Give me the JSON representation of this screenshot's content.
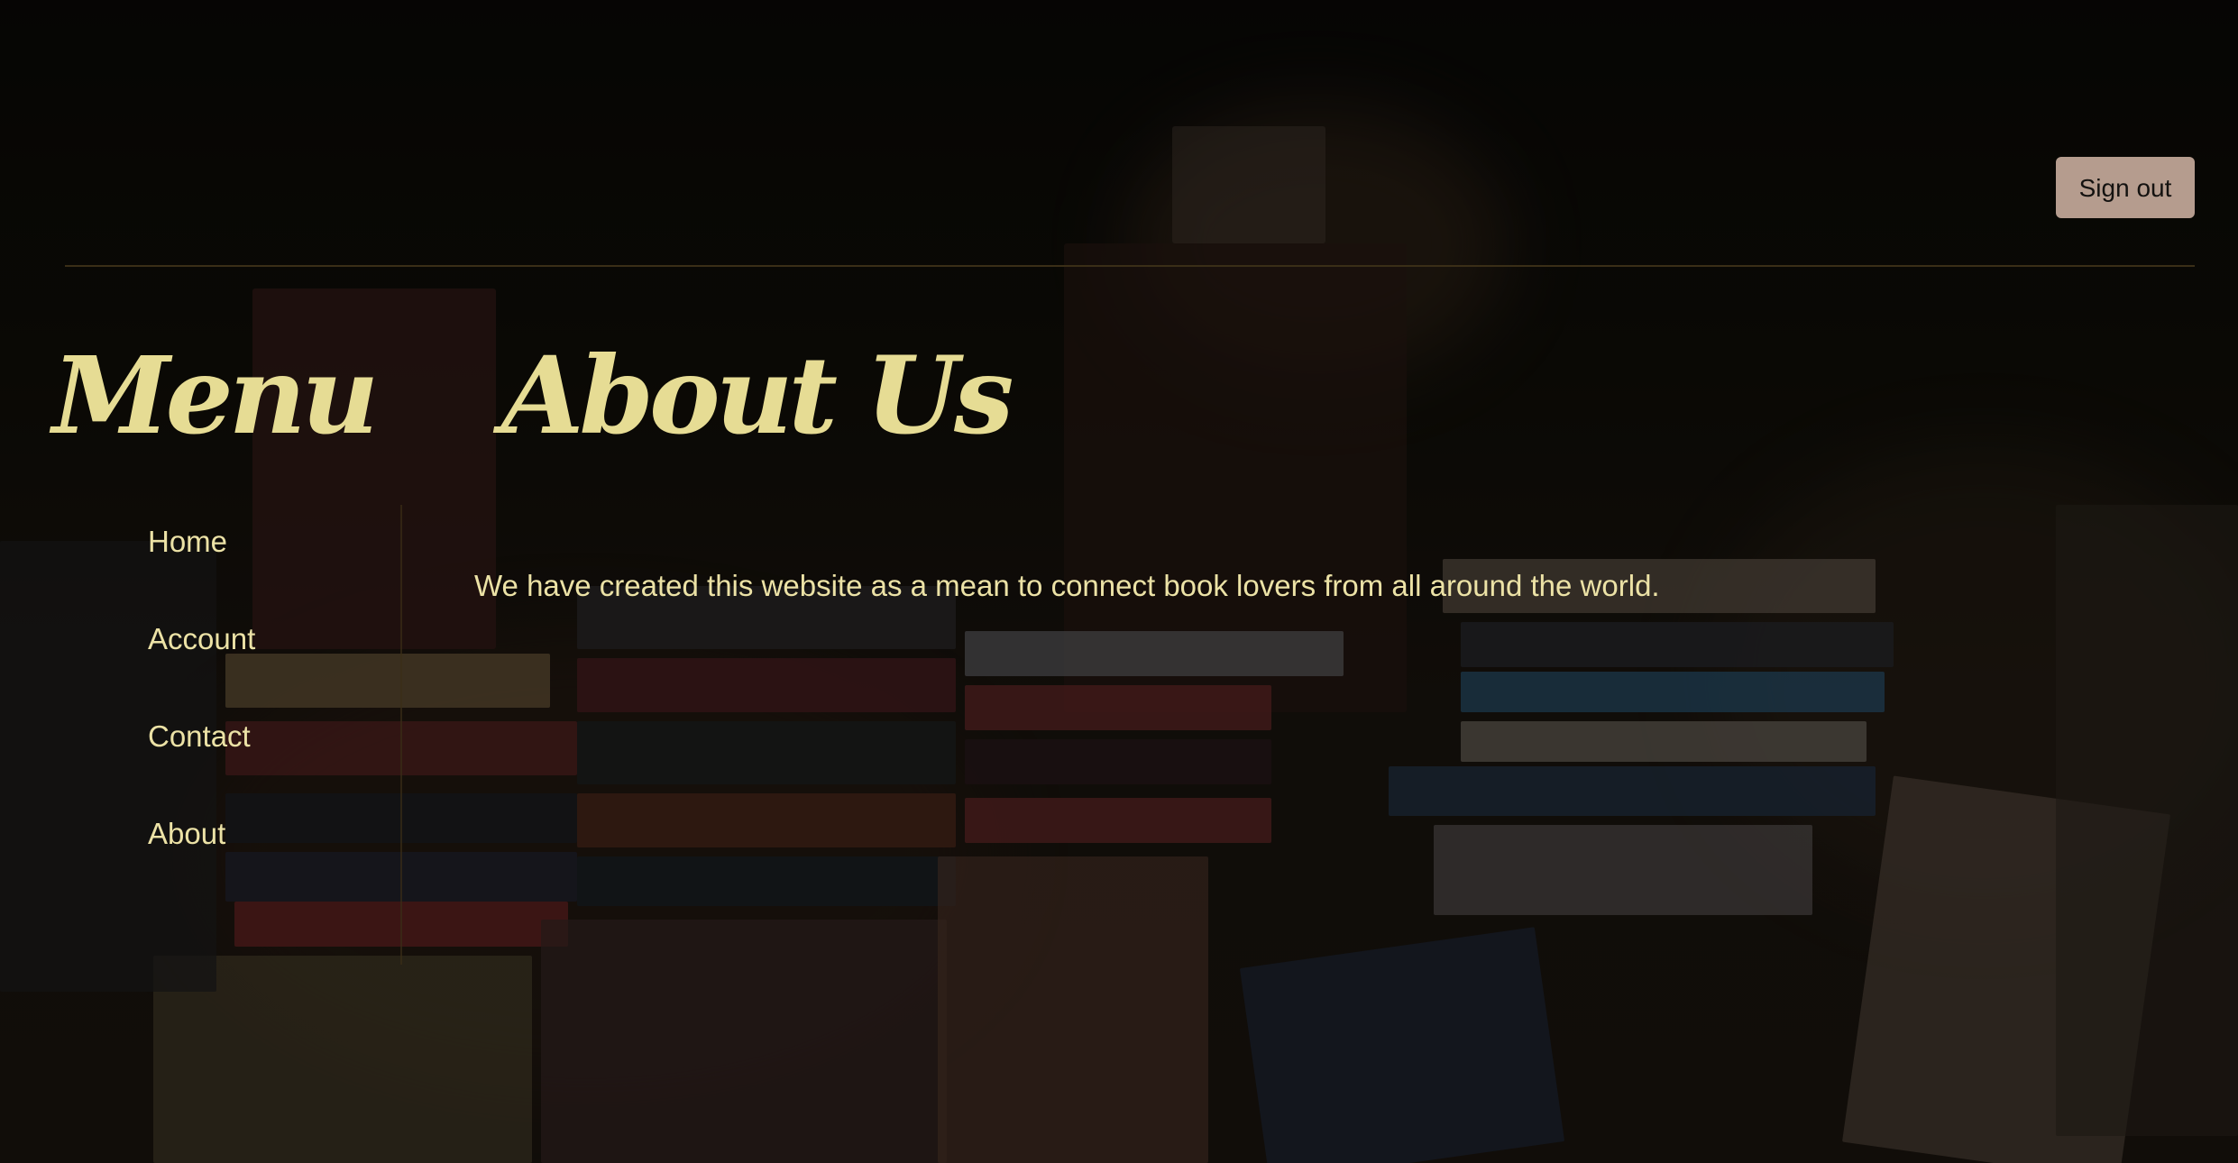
{
  "header": {
    "sign_out_label": "Sign out"
  },
  "sidebar": {
    "title": "Menu",
    "items": [
      {
        "label": "Home"
      },
      {
        "label": "Account"
      },
      {
        "label": "Contact"
      },
      {
        "label": "About"
      }
    ]
  },
  "main": {
    "title": "About Us",
    "body": "We have created this website as a mean to connect book lovers from all around the world."
  },
  "colors": {
    "heading": "#e6dc94",
    "text": "#ece2a6",
    "button_bg": "#b59c8e",
    "rule": "#3a2e17"
  }
}
